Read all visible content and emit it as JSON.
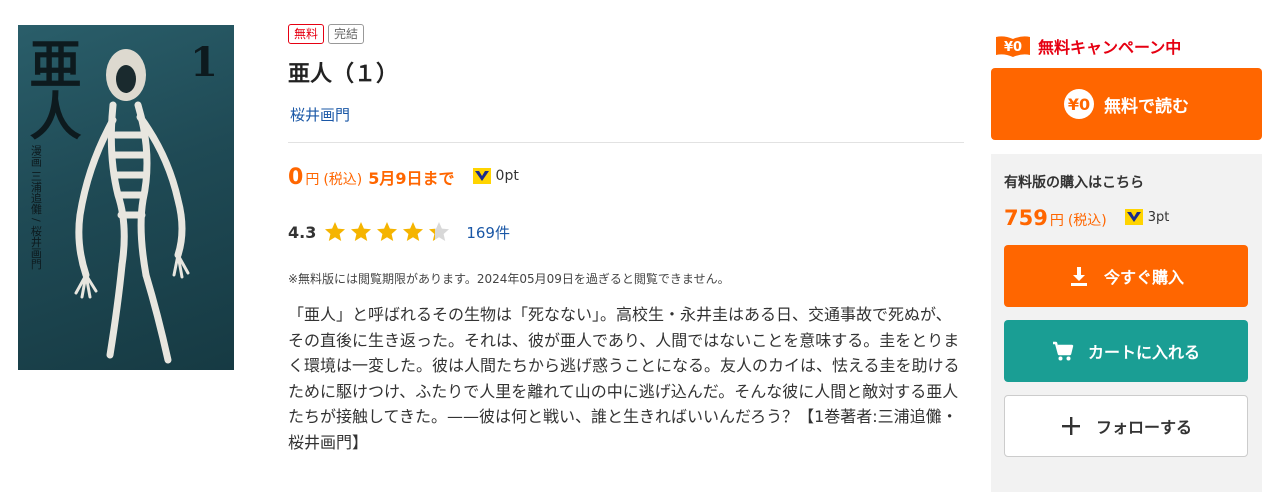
{
  "cover": {
    "title": "亜人",
    "volume": "1",
    "author_text": "漫画 三浦追儺 / 桜井画門"
  },
  "badges": {
    "free": "無料",
    "complete": "完結"
  },
  "book": {
    "title": "亜人（１）",
    "author": "桜井画門"
  },
  "price": {
    "value": "0",
    "unit": "円",
    "tax": "(税込)",
    "until": "5月9日まで",
    "points": "0pt"
  },
  "rating": {
    "score": "4.3",
    "stars": 4.3,
    "count": "169件"
  },
  "notice": "※無料版には閲覧期限があります。2024年05月09日を過ぎると閲覧できません。",
  "description": "「亜人」と呼ばれるその生物は「死なない」。高校生・永井圭はある日、交通事故で死ぬが、その直後に生き返った。それは、彼が亜人であり、人間ではないことを意味する。圭をとりまく環境は一変した。彼は人間たちから逃げ惑うことになる。友人のカイは、怯える圭を助けるために駆けつけ、ふたりで人里を離れて山の中に逃げ込んだ。そんな彼に人間と敵対する亜人たちが接触してきた。——彼は何と戦い、誰と生きればいいんだろう？【1巻著者:三浦追儺・桜井画門】",
  "campaign": {
    "icon_text": "¥0",
    "label": "無料キャンペーン中"
  },
  "free_button": {
    "icon_text": "¥0",
    "label": "無料で読む"
  },
  "paid": {
    "heading": "有料版の購入はこちら",
    "price": "759",
    "unit": "円",
    "tax": "(税込)",
    "points": "3pt",
    "buy_label": "今すぐ購入",
    "cart_label": "カートに入れる",
    "follow_label": "フォローする"
  },
  "colors": {
    "accent": "#ff6600",
    "free_red": "#e60012",
    "cart_teal": "#1a9e94",
    "link_blue": "#1a57a6",
    "star": "#f5b400"
  }
}
